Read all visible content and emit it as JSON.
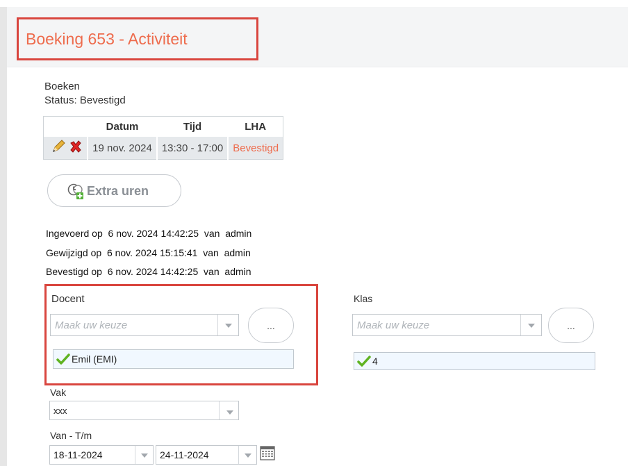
{
  "header": {
    "title": "Boeking 653 - Activiteit"
  },
  "booking": {
    "section_label": "Boeken",
    "status": "Status: Bevestigd",
    "columns": [
      "",
      "Datum",
      "Tijd",
      "LHA"
    ],
    "rows": [
      {
        "date": "19 nov. 2024",
        "time": "13:30 - 17:00",
        "lha": "Bevestigd"
      }
    ]
  },
  "extra_hours_button": {
    "label": "Extra uren"
  },
  "meta": [
    {
      "label": "Ingevoerd op",
      "datetime": "6 nov. 2024 14:42:25",
      "by": "van",
      "user": "admin"
    },
    {
      "label": "Gewijzigd op",
      "datetime": "6 nov. 2024 15:15:41",
      "by": "van",
      "user": "admin"
    },
    {
      "label": "Bevestigd op",
      "datetime": "6 nov. 2024 14:42:25",
      "by": "van",
      "user": "admin"
    }
  ],
  "docent": {
    "label": "Docent",
    "placeholder": "Maak uw keuze",
    "browse": "...",
    "selected": "Emil (EMI)"
  },
  "klas": {
    "label": "Klas",
    "placeholder": "Maak uw keuze",
    "browse": "...",
    "selected": "4"
  },
  "vak": {
    "label": "Vak",
    "value": "xxx"
  },
  "period": {
    "label": "Van - T/m",
    "from": "18-11-2024",
    "to": "24-11-2024"
  },
  "colors": {
    "accent": "#ee6c4d",
    "highlight": "#d9453e",
    "check": "#5fb321"
  }
}
